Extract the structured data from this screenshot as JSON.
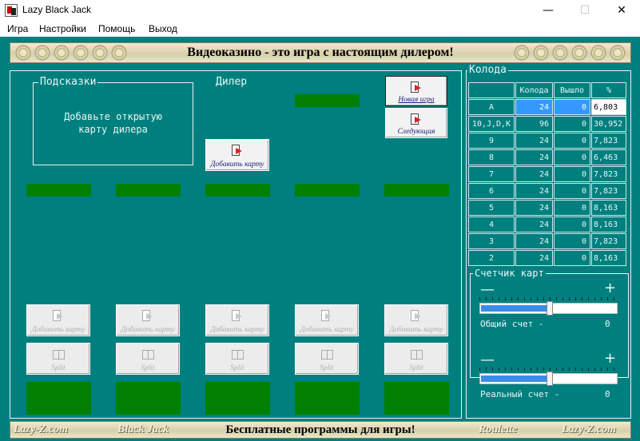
{
  "window": {
    "title": "Lazy Black Jack",
    "minimize_glyph": "—",
    "maximize_glyph": "☐",
    "close_glyph": "✕"
  },
  "menu": [
    "Игра",
    "Настройки",
    "Помощь",
    "Выход"
  ],
  "banner_top": "Видеоказино - это игра с настоящим дилером!",
  "banner_bottom": {
    "left_logo": "Lazy-Z.com",
    "left_item": "Black Jack",
    "center": "Бесплатные программы для игры!",
    "right_item": "Roulette",
    "right_logo": "Lazy-Z.com"
  },
  "hints": {
    "title": "Подсказки",
    "line1": "Добавьте открытую",
    "line2": "карту дилера"
  },
  "dealer": {
    "title": "Дилер",
    "add_card_label": "Добавить карту"
  },
  "buttons": {
    "new_game": "Новая игра",
    "next": "Следующая"
  },
  "players": {
    "add_card_label": "Добавить карту",
    "split_label": "Split",
    "count": 5
  },
  "deck": {
    "title": "Колода",
    "columns": [
      "",
      "Колода",
      "Вышло",
      "%"
    ],
    "rows": [
      {
        "card": "A",
        "deck": "24",
        "out": "0",
        "pct": "6,803"
      },
      {
        "card": "10,J,D,K",
        "deck": "96",
        "out": "0",
        "pct": "30,952"
      },
      {
        "card": "9",
        "deck": "24",
        "out": "0",
        "pct": "7,823"
      },
      {
        "card": "8",
        "deck": "24",
        "out": "0",
        "pct": "6,463"
      },
      {
        "card": "7",
        "deck": "24",
        "out": "0",
        "pct": "7,823"
      },
      {
        "card": "6",
        "deck": "24",
        "out": "0",
        "pct": "7,823"
      },
      {
        "card": "5",
        "deck": "24",
        "out": "0",
        "pct": "8,163"
      },
      {
        "card": "4",
        "deck": "24",
        "out": "0",
        "pct": "8,163"
      },
      {
        "card": "3",
        "deck": "24",
        "out": "0",
        "pct": "7,823"
      },
      {
        "card": "2",
        "deck": "24",
        "out": "0",
        "pct": "8,163"
      }
    ]
  },
  "counter": {
    "title": "Счетчик карт",
    "minus": "—",
    "plus": "+",
    "total_label": "Общий счет -",
    "total_value": "0",
    "real_label": "Реальный счет -",
    "real_value": "0",
    "slider1_level": 0.5,
    "slider2_level": 0.5
  },
  "colors": {
    "table_felt": "#007f7f",
    "card_slot": "#007f00",
    "selected": "#3399ff"
  }
}
